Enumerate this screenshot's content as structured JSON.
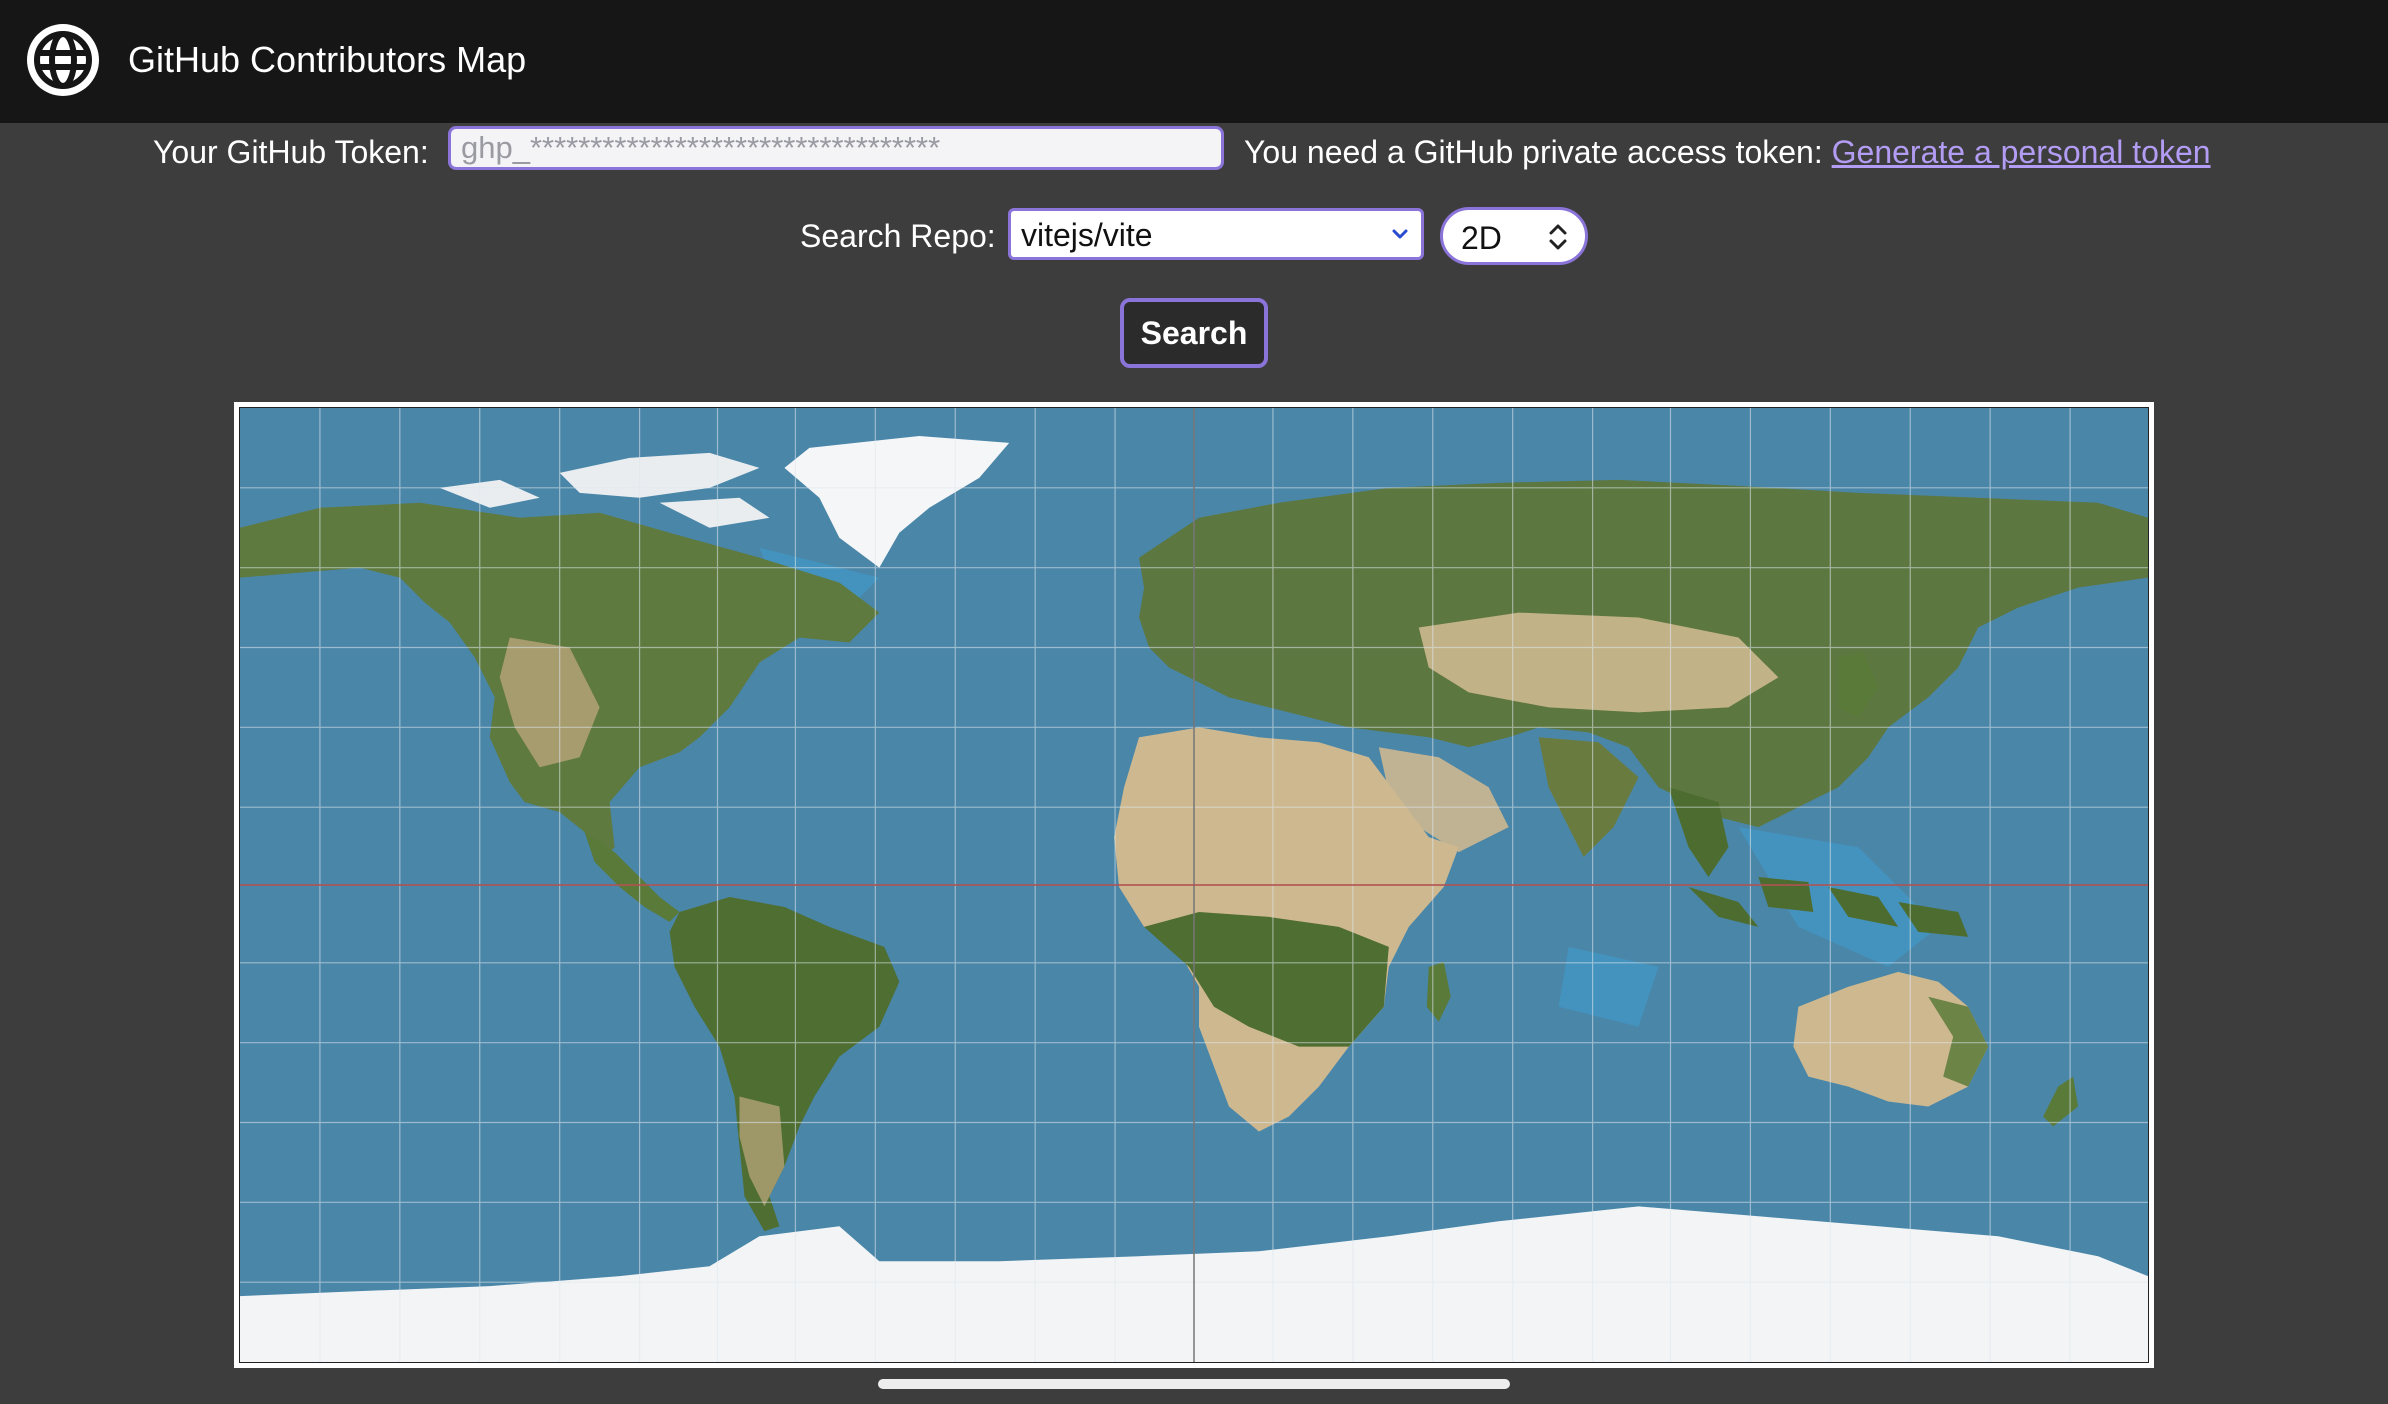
{
  "header": {
    "title": "GitHub Contributors Map",
    "logo_icon": "globe-icon"
  },
  "token": {
    "label": "Your GitHub Token:",
    "placeholder": "ghp_**********************************",
    "note": "You need a GitHub private access token:",
    "link_text": "Generate a personal token"
  },
  "repo": {
    "label": "Search Repo:",
    "selected": "vitejs/vite"
  },
  "mode": {
    "selected": "2D"
  },
  "search_button": {
    "label": "Search"
  },
  "map": {
    "projection": "equirectangular world map",
    "ocean_color": "#4a86a8",
    "land_color": "#6b7f45",
    "desert_color": "#cdb890",
    "ice_color": "#f2f4f6",
    "equator_color": "#b04a4a"
  },
  "colors": {
    "accent": "#8b74d9",
    "link": "#b39cf3",
    "header_bg": "#161616",
    "page_bg": "#3d3d3d"
  }
}
